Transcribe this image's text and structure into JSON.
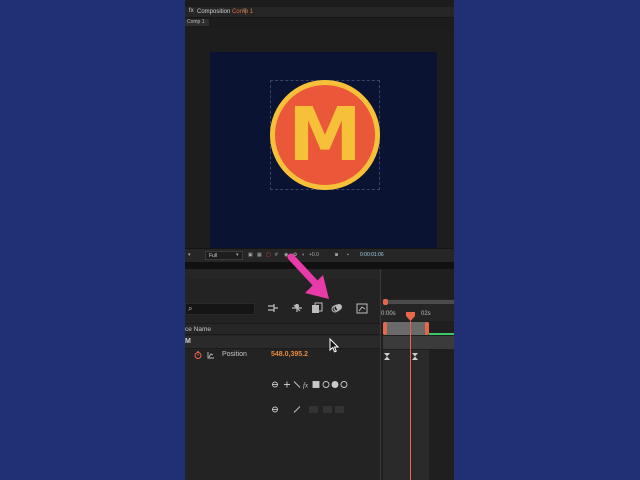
{
  "composition": {
    "tab_label": "Composition",
    "comp_name": "Comp 1",
    "tab_menu": "≡",
    "subtab_label": "Comp 1",
    "logo_letter": "M"
  },
  "viewer_toolbar": {
    "resolution": "Full",
    "exposure": "+0.0",
    "timecode": "0:00:01:06"
  },
  "timeline": {
    "search_placeholder": "",
    "column_name": "ce Name",
    "layer_name": "M",
    "property_name": "Position",
    "property_value": "548.0,395.2",
    "ruler_start": "0:00s",
    "ruler_mark": "02s"
  },
  "colors": {
    "background": "#213074",
    "accent_orange": "#e8674a",
    "logo_yellow": "#f6c139",
    "logo_red": "#ea5739",
    "arrow_pink": "#e83aa8"
  },
  "icons": [
    "search-icon",
    "comp-flowchart-icon",
    "shy-layers-icon",
    "frame-blending-icon",
    "motion-blur-icon",
    "graph-editor-icon",
    "stopwatch-icon",
    "keyframe-icon",
    "cursor-icon",
    "pointer-arrow-icon"
  ]
}
